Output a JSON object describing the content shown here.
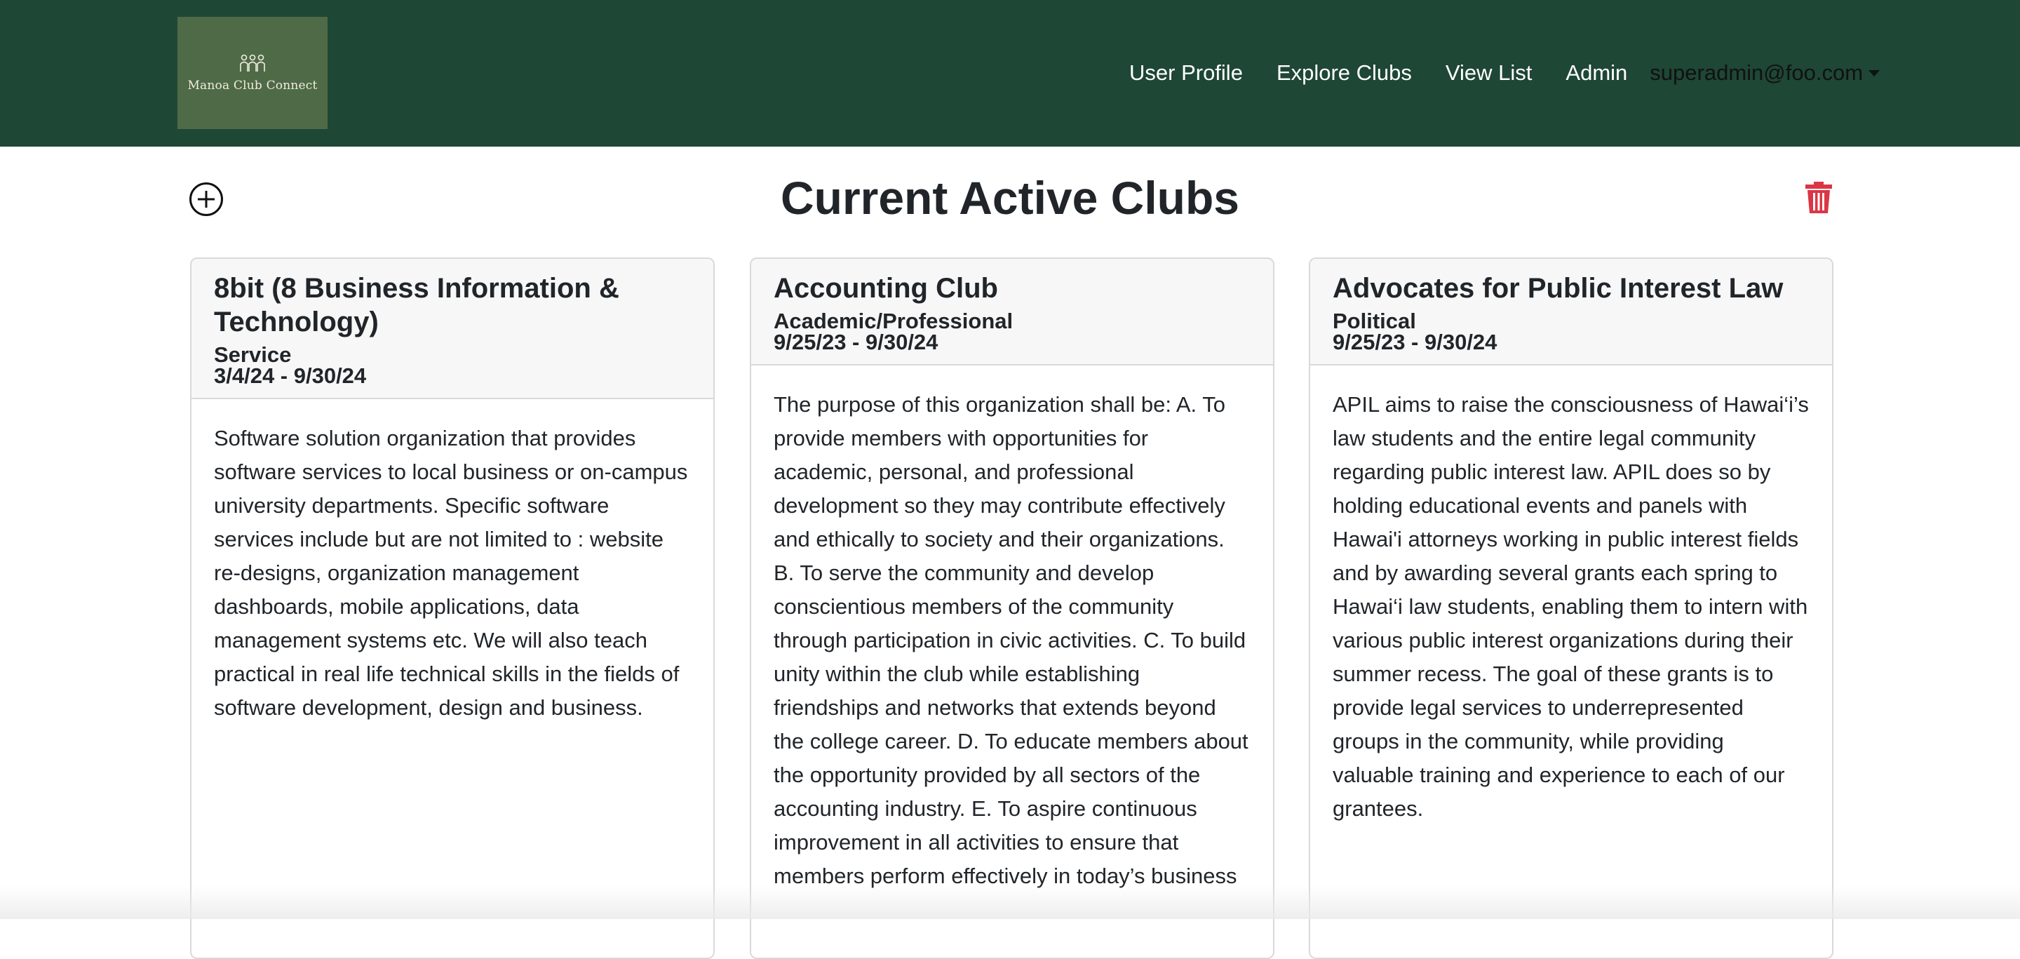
{
  "navbar": {
    "logo_text": "Manoa Club Connect",
    "links": [
      "User Profile",
      "Explore Clubs",
      "View List",
      "Admin"
    ],
    "user": "superadmin@foo.com"
  },
  "page": {
    "title": "Current Active Clubs"
  },
  "icons": {
    "add": "plus-circle-icon",
    "delete": "trash-icon"
  },
  "colors": {
    "navbar": "#1e4735",
    "logo_bg": "#4f6a46",
    "delete": "#dc3545"
  },
  "clubs": [
    {
      "name": "8bit (8 Business Information & Technology)",
      "type": "Service",
      "dates": "3/4/24 - 9/30/24",
      "description": "Software solution organization that provides software services to local business or on-campus university departments. Specific software services include but are not limited to : website re-designs, organization management dashboards, mobile applications, data management systems etc. We will also teach practical in real life technical skills in the fields of software development, design and business."
    },
    {
      "name": "Accounting Club",
      "type": "Academic/Professional",
      "dates": "9/25/23 - 9/30/24",
      "description": "The purpose of this organization shall be: A. To provide members with opportunities for academic, personal, and professional development so they may contribute effectively and ethically to society and their organizations. B. To serve the community and develop conscientious members of the community through participation in civic activities. C. To build unity within the club while establishing friendships and networks that extends beyond the college career. D. To educate members about the opportunity provided by all sectors of the accounting industry. E. To aspire continuous improvement in all activities to ensure that members perform effectively in today’s business"
    },
    {
      "name": "Advocates for Public Interest Law",
      "type": "Political",
      "dates": "9/25/23 - 9/30/24",
      "description": "APIL aims to raise the consciousness of Hawai‘i’s law students and the entire legal community regarding public interest law. APIL does so by holding educational events and panels with Hawai'i attorneys working in public interest fields and by awarding several grants each spring to Hawai‘i law students, enabling them to intern with various public interest organizations during their summer recess. The goal of these grants is to provide legal services to underrepresented groups in the community, while providing valuable training and experience to each of our grantees."
    }
  ]
}
